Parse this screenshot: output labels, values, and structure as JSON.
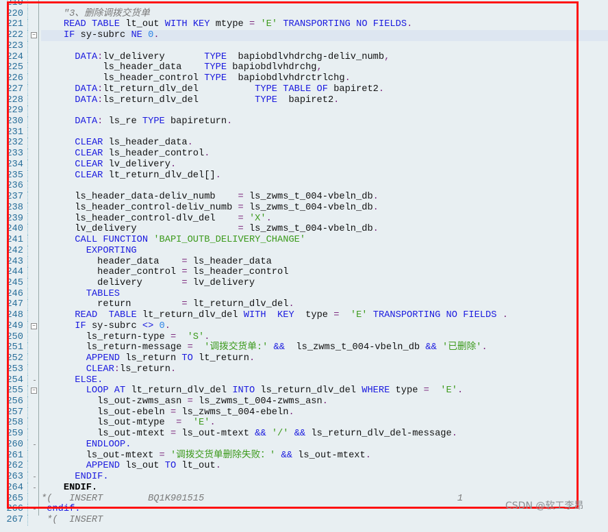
{
  "editor": {
    "current_line": 22,
    "fold_lines": [
      22,
      49,
      55
    ],
    "end_fold_lines": [
      54,
      60,
      63,
      64,
      266
    ],
    "lines": [
      {
        "n": "219",
        "text": ""
      },
      {
        "n": "220",
        "text": "    \"3、删除调拨交货单"
      },
      {
        "n": "221",
        "text": "    READ TABLE lt_out WITH KEY mtype = 'E' TRANSPORTING NO FIELDS."
      },
      {
        "n": "222",
        "text": "    IF sy-subrc NE 0."
      },
      {
        "n": "223",
        "text": ""
      },
      {
        "n": "224",
        "text": "      DATA:lv_delivery       TYPE  bapiobdlvhdrchg-deliv_numb,"
      },
      {
        "n": "225",
        "text": "           ls_header_data    TYPE bapiobdlvhdrchg,"
      },
      {
        "n": "226",
        "text": "           ls_header_control TYPE  bapiobdlvhdrctrlchg."
      },
      {
        "n": "227",
        "text": "      DATA:lt_return_dlv_del          TYPE TABLE OF bapiret2."
      },
      {
        "n": "228",
        "text": "      DATA:ls_return_dlv_del          TYPE  bapiret2."
      },
      {
        "n": "229",
        "text": ""
      },
      {
        "n": "230",
        "text": "      DATA: ls_re TYPE bapireturn."
      },
      {
        "n": "231",
        "text": ""
      },
      {
        "n": "232",
        "text": "      CLEAR ls_header_data."
      },
      {
        "n": "233",
        "text": "      CLEAR ls_header_control."
      },
      {
        "n": "234",
        "text": "      CLEAR lv_delivery."
      },
      {
        "n": "235",
        "text": "      CLEAR lt_return_dlv_del[]."
      },
      {
        "n": "236",
        "text": ""
      },
      {
        "n": "237",
        "text": "      ls_header_data-deliv_numb    = ls_zwms_t_004-vbeln_db."
      },
      {
        "n": "238",
        "text": "      ls_header_control-deliv_numb = ls_zwms_t_004-vbeln_db."
      },
      {
        "n": "239",
        "text": "      ls_header_control-dlv_del    = 'X'."
      },
      {
        "n": "240",
        "text": "      lv_delivery                  = ls_zwms_t_004-vbeln_db."
      },
      {
        "n": "241",
        "text": "      CALL FUNCTION 'BAPI_OUTB_DELIVERY_CHANGE'"
      },
      {
        "n": "242",
        "text": "        EXPORTING"
      },
      {
        "n": "243",
        "text": "          header_data    = ls_header_data"
      },
      {
        "n": "244",
        "text": "          header_control = ls_header_control"
      },
      {
        "n": "245",
        "text": "          delivery       = lv_delivery"
      },
      {
        "n": "246",
        "text": "        TABLES"
      },
      {
        "n": "247",
        "text": "          return         = lt_return_dlv_del."
      },
      {
        "n": "248",
        "text": "      READ  TABLE lt_return_dlv_del WITH  KEY  type =  'E' TRANSPORTING NO FIELDS ."
      },
      {
        "n": "249",
        "text": "      IF sy-subrc <> 0."
      },
      {
        "n": "250",
        "text": "        ls_return-type =  'S'."
      },
      {
        "n": "251",
        "text": "        ls_return-message =  '调拨交货单:' &&  ls_zwms_t_004-vbeln_db && '已删除'."
      },
      {
        "n": "252",
        "text": "        APPEND ls_return TO lt_return."
      },
      {
        "n": "253",
        "text": "        CLEAR:ls_return."
      },
      {
        "n": "254",
        "text": "      ELSE."
      },
      {
        "n": "255",
        "text": "        LOOP AT lt_return_dlv_del INTO ls_return_dlv_del WHERE type =  'E'."
      },
      {
        "n": "256",
        "text": "          ls_out-zwms_asn = ls_zwms_t_004-zwms_asn."
      },
      {
        "n": "257",
        "text": "          ls_out-ebeln = ls_zwms_t_004-ebeln."
      },
      {
        "n": "258",
        "text": "          ls_out-mtype  =  'E'."
      },
      {
        "n": "259",
        "text": "          ls_out-mtext = ls_out-mtext && '/' && ls_return_dlv_del-message."
      },
      {
        "n": "260",
        "text": "        ENDLOOP."
      },
      {
        "n": "261",
        "text": "        ls_out-mtext = '调拨交货单删除失败：' && ls_out-mtext."
      },
      {
        "n": "262",
        "text": "        APPEND ls_out TO lt_out."
      },
      {
        "n": "263",
        "text": "      ENDIF."
      },
      {
        "n": "264",
        "text": "    ENDIF."
      },
      {
        "n": "265",
        "text": "*(   INSERT        BQ1K901515                                             1"
      },
      {
        "n": "266",
        "text": " endif."
      },
      {
        "n": "267",
        "text": " *(  INSERT"
      }
    ]
  },
  "colors": {
    "keyword": "#1a1adf",
    "string": "#3c9a1c",
    "number": "#2f86e6",
    "comment": "#7a7a7a",
    "highlight_box": "#ff1010",
    "background": "#e8eff2"
  },
  "watermark": "CSDN @软工李昂"
}
